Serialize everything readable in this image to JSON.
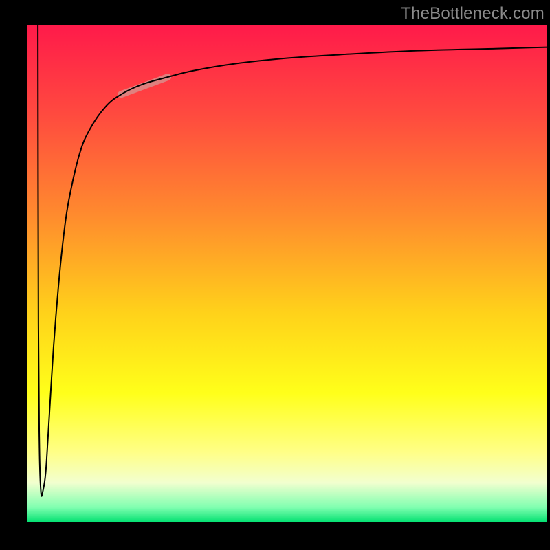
{
  "watermark": "TheBottleneck.com",
  "chart_data": {
    "type": "line",
    "title": "",
    "xlabel": "",
    "ylabel": "",
    "xlim": [
      0,
      100
    ],
    "ylim": [
      0,
      100
    ],
    "grid": false,
    "background_gradient": {
      "stops": [
        {
          "pct": 0,
          "color": "#ff1a4a"
        },
        {
          "pct": 18,
          "color": "#ff4a3f"
        },
        {
          "pct": 38,
          "color": "#ff8a2e"
        },
        {
          "pct": 58,
          "color": "#ffd21a"
        },
        {
          "pct": 74,
          "color": "#ffff1a"
        },
        {
          "pct": 86,
          "color": "#ffff88"
        },
        {
          "pct": 92,
          "color": "#f2ffcf"
        },
        {
          "pct": 97,
          "color": "#7fffb0"
        },
        {
          "pct": 100,
          "color": "#00e070"
        }
      ]
    },
    "series": [
      {
        "name": "curve",
        "color": "#000000",
        "width": 2,
        "type": "line",
        "x": [
          2.0,
          2.1,
          2.3,
          2.6,
          3.0,
          3.5,
          4.0,
          5.0,
          6.0,
          7.0,
          8.0,
          10.0,
          12.0,
          15.0,
          18.0,
          22.0,
          27.0,
          32.0,
          40.0,
          50.0,
          60.0,
          75.0,
          90.0,
          100.0
        ],
        "y": [
          100.0,
          40.0,
          15.0,
          6.0,
          6.5,
          10.0,
          18.0,
          35.0,
          48.0,
          58.0,
          65.0,
          74.0,
          79.0,
          83.5,
          86.0,
          88.0,
          89.5,
          90.8,
          92.2,
          93.3,
          94.0,
          94.8,
          95.2,
          95.5
        ]
      },
      {
        "name": "highlight",
        "color": "#d98d8a",
        "width": 10,
        "opacity": 0.85,
        "type": "segment",
        "x": [
          18.0,
          27.0
        ],
        "y": [
          86.0,
          89.5
        ]
      }
    ],
    "annotations": []
  }
}
